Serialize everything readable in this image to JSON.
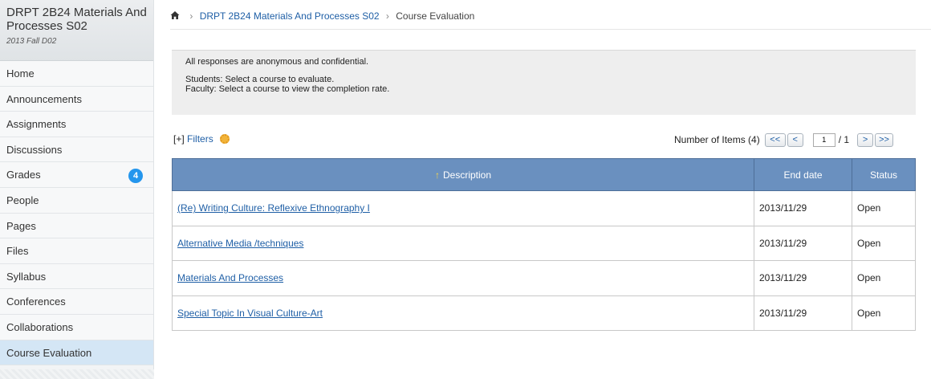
{
  "sidebar": {
    "course_title": "DRPT 2B24 Materials And Processes S02",
    "course_term": "2013 Fall D02",
    "items": [
      {
        "label": "Home"
      },
      {
        "label": "Announcements"
      },
      {
        "label": "Assignments"
      },
      {
        "label": "Discussions"
      },
      {
        "label": "Grades",
        "badge": "4"
      },
      {
        "label": "People"
      },
      {
        "label": "Pages"
      },
      {
        "label": "Files"
      },
      {
        "label": "Syllabus"
      },
      {
        "label": "Conferences"
      },
      {
        "label": "Collaborations"
      },
      {
        "label": "Course Evaluation",
        "active": true
      }
    ]
  },
  "breadcrumb": {
    "home_icon": "home-icon",
    "course_link": "DRPT 2B24 Materials And Processes S02",
    "current": "Course Evaluation"
  },
  "info": {
    "line1": "All responses are anonymous and confidential.",
    "line2": "Students: Select a course to evaluate.",
    "line3": "Faculty: Select a course to view the completion rate."
  },
  "toolbar": {
    "filters_prefix": "[+]",
    "filters_label": "Filters",
    "items_count_label": "Number of Items (4)",
    "first_label": "<<",
    "prev_label": "<",
    "page_value": "1",
    "page_total": "/ 1",
    "next_label": ">",
    "last_label": ">>"
  },
  "table": {
    "headers": {
      "description": "Description",
      "end_date": "End date",
      "status": "Status"
    },
    "rows": [
      {
        "description": "(Re) Writing Culture: Reflexive Ethnography I",
        "end_date": "2013/11/29",
        "status": "Open"
      },
      {
        "description": "Alternative Media /techniques",
        "end_date": "2013/11/29",
        "status": "Open"
      },
      {
        "description": "Materials And Processes",
        "end_date": "2013/11/29",
        "status": "Open"
      },
      {
        "description": "Special Topic In Visual Culture-Art",
        "end_date": "2013/11/29",
        "status": "Open"
      }
    ]
  },
  "colors": {
    "header_blue": "#6a90bf",
    "link_blue": "#1f5fa6",
    "badge_blue": "#2496ed",
    "active_nav": "#d4e6f5"
  }
}
